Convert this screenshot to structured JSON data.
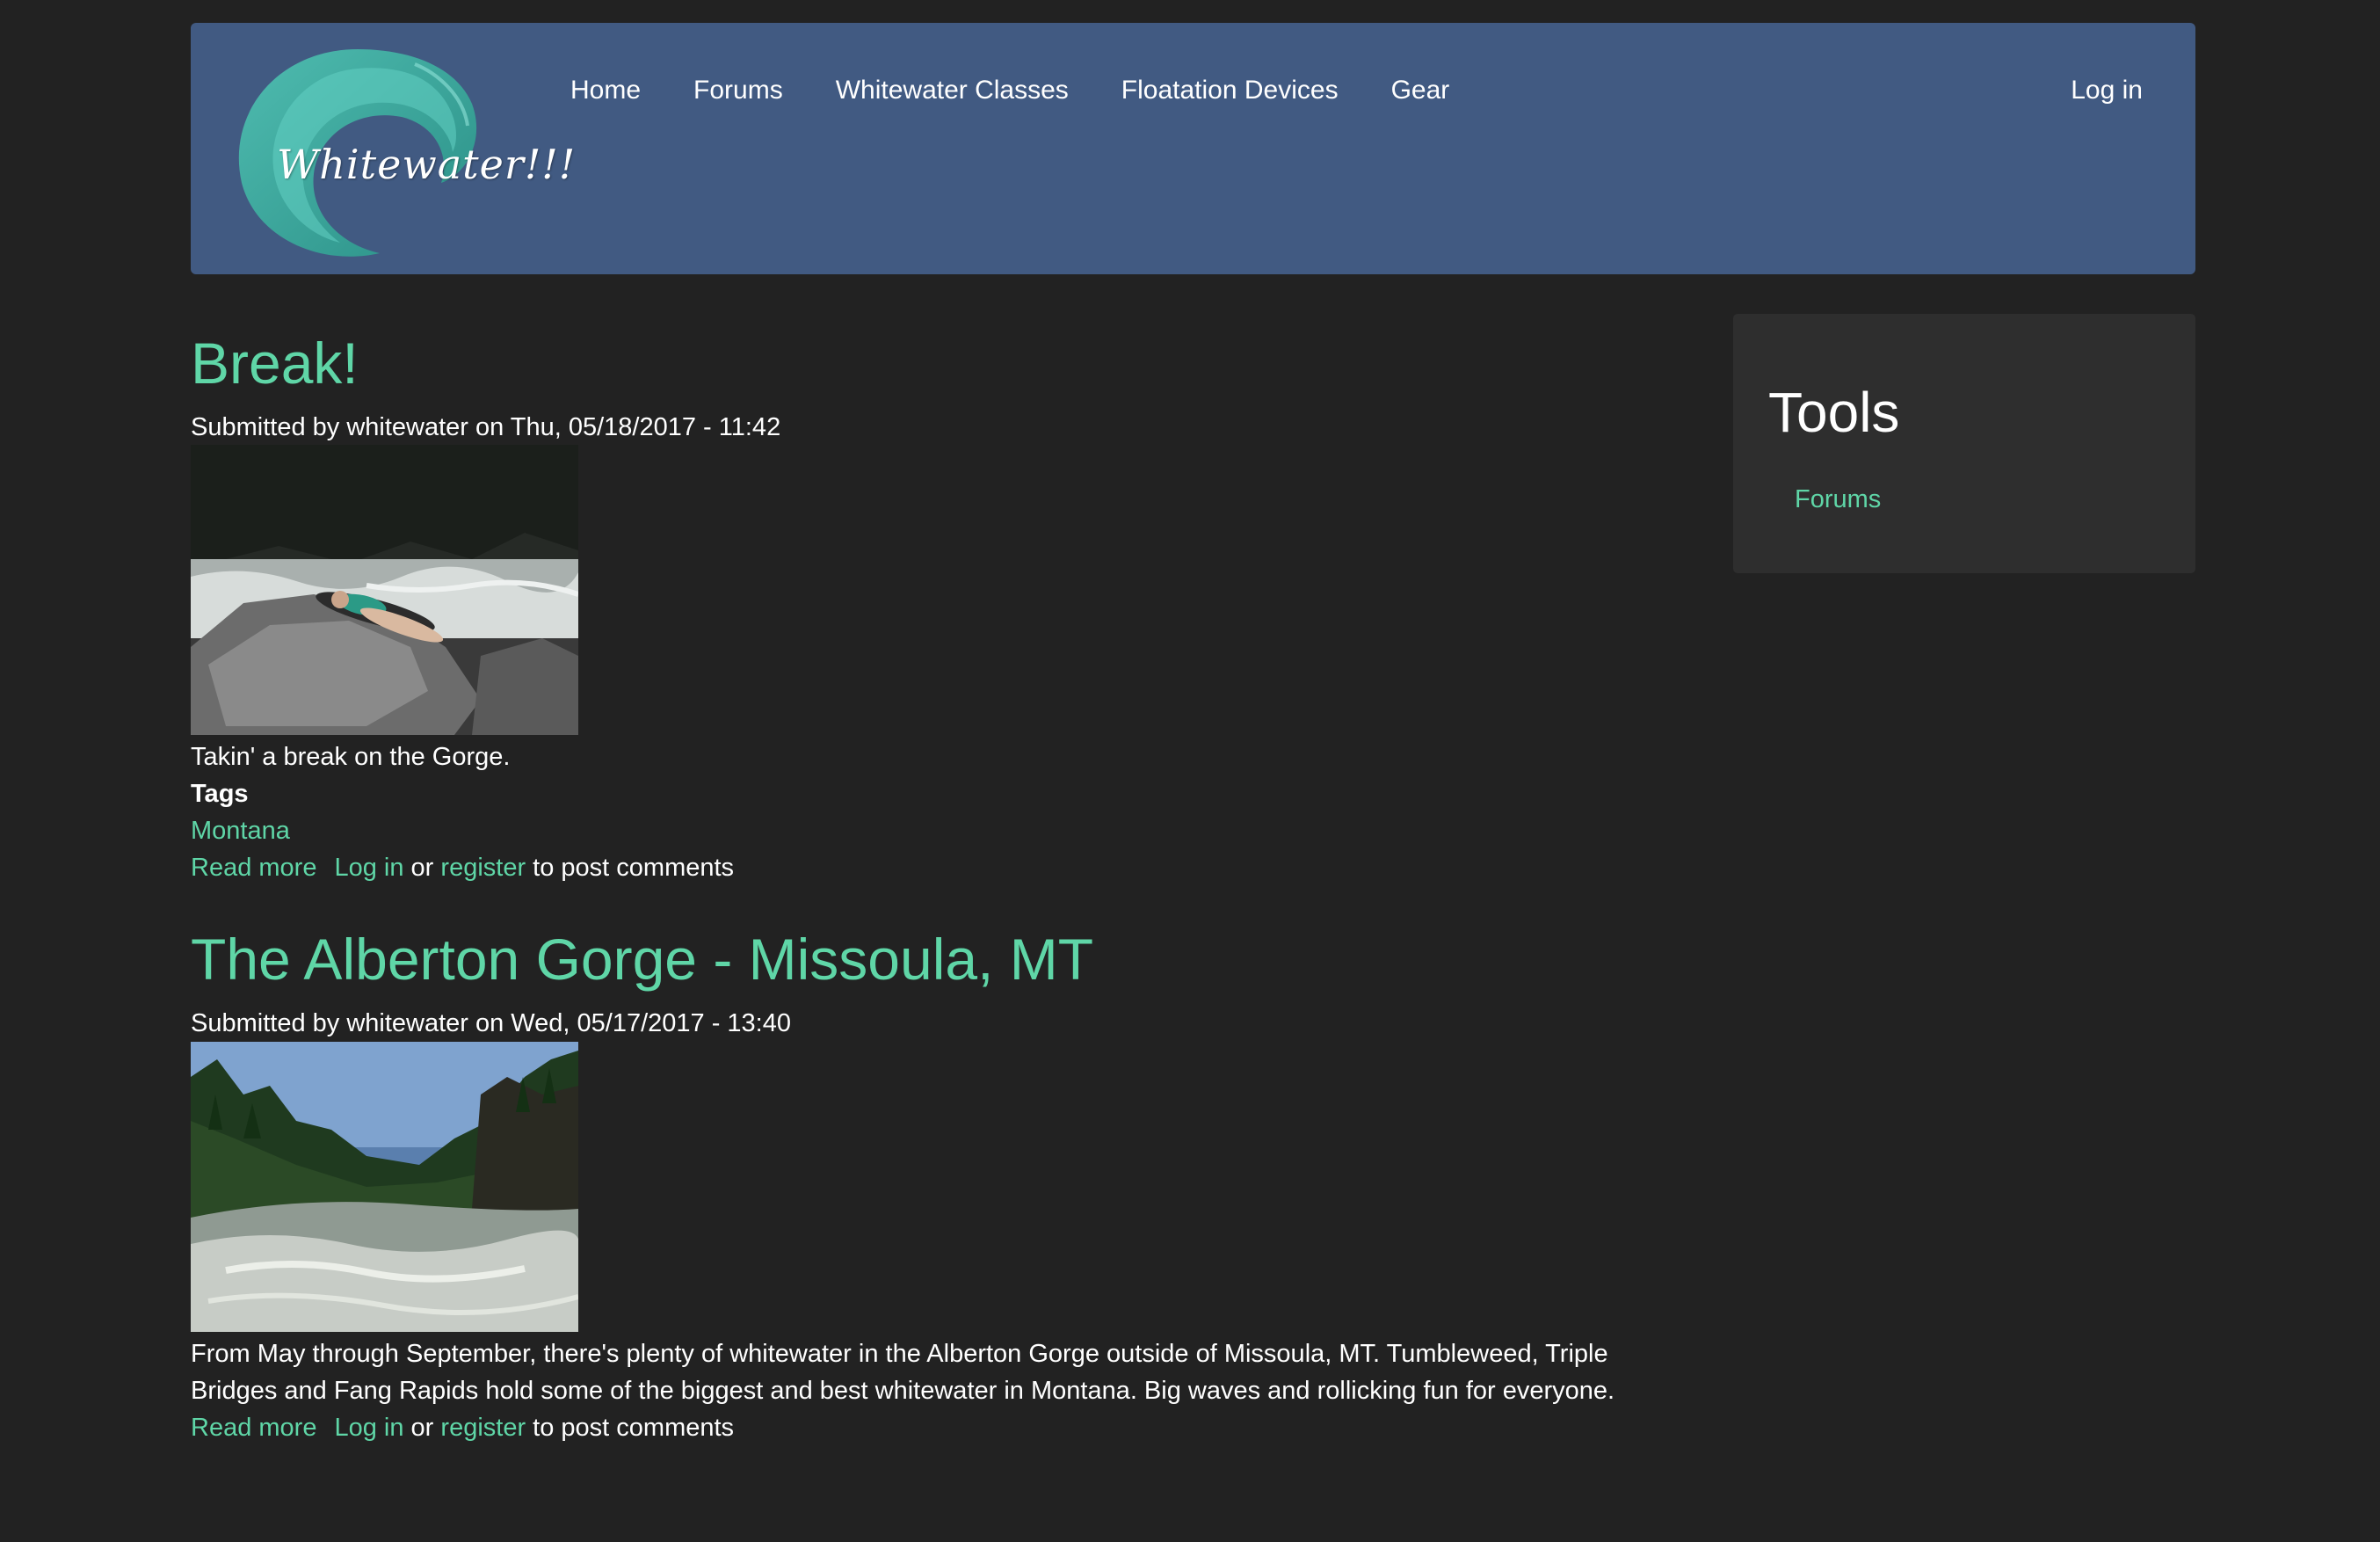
{
  "site": {
    "logo_text": "Whitewater!!!",
    "colors": {
      "background": "#222222",
      "header": "#415a82",
      "accent": "#5fd6a7",
      "sidebar": "#2e2e2e"
    }
  },
  "nav": {
    "items": [
      {
        "label": "Home"
      },
      {
        "label": "Forums"
      },
      {
        "label": "Whitewater Classes"
      },
      {
        "label": "Floatation Devices"
      },
      {
        "label": "Gear"
      }
    ],
    "login": "Log in"
  },
  "posts": [
    {
      "title": "Break!",
      "submitted": "Submitted by whitewater on Thu, 05/18/2017 - 11:42",
      "image": "photo of people resting on rocks beside rapids",
      "body": "Takin' a break on the Gorge.",
      "tags_label": "Tags",
      "tags": [
        "Montana"
      ],
      "links": {
        "read_more": "Read more",
        "login": "Log in",
        "or": "or",
        "register": "register",
        "suffix": "to post comments"
      }
    },
    {
      "title": "The Alberton Gorge - Missoula, MT",
      "submitted": "Submitted by whitewater on Wed, 05/17/2017 - 13:40",
      "image": "photo of river rapids through a forested gorge",
      "body": "From May through September, there's plenty of whitewater in the Alberton Gorge outside of Missoula, MT. Tumbleweed, Triple Bridges and Fang Rapids hold some of the biggest and best whitewater in Montana. Big waves and rollicking fun for everyone.",
      "links": {
        "read_more": "Read more",
        "login": "Log in",
        "or": "or",
        "register": "register",
        "suffix": "to post comments"
      }
    }
  ],
  "sidebar": {
    "title": "Tools",
    "links": [
      {
        "label": "Forums"
      }
    ]
  }
}
